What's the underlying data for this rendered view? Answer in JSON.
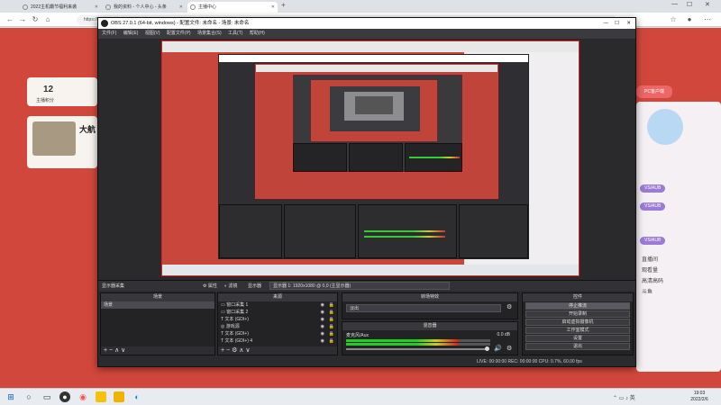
{
  "browser": {
    "tabs": [
      {
        "label": "2022主机霸节福利来袭"
      },
      {
        "label": "我的资料 - 个人中心 - 头条"
      },
      {
        "label": "主播中心"
      }
    ],
    "url": "https://",
    "window_controls": {
      "minimize": "—",
      "maximize": "☐",
      "close": "✕"
    }
  },
  "webpage": {
    "count": "12",
    "count_label": "主播积分",
    "username": "大航",
    "badge": "PC客户端",
    "pills": [
      "VS/AUB",
      "VS/AUB",
      "VS/AUB"
    ],
    "side_text": [
      "直播间",
      "观看量",
      "高清高码",
      "斗鱼"
    ]
  },
  "obs": {
    "title": "OBS 27.0.1 (64-bit, windows) - 配置文件: 未命名 - 场景: 未命名",
    "menu": [
      "文件(F)",
      "编辑(E)",
      "视图(V)",
      "配置文件(P)",
      "场景集合(S)",
      "工具(T)",
      "帮助(H)"
    ],
    "bar": {
      "display_label": "显示器采集",
      "properties": "属性",
      "filters": "滤镜",
      "display_select_label": "显示器",
      "display_select_value": "显示器 1: 1920x1080 @ 0,0 (主显示器)"
    },
    "scenes": {
      "header": "场景",
      "items": [
        "场景"
      ],
      "footer": "+ − ∧ ∨"
    },
    "sources": {
      "header": "来源",
      "items": [
        "窗口采集 1",
        "窗口采集 2",
        "文本 (GDI+)",
        "游戏源",
        "文本 (GDI+)",
        "文本 (GDI+) 4"
      ],
      "footer": "+ − ⚙ ∧ ∨"
    },
    "transitions": {
      "header": "转场特效",
      "value": "淡出"
    },
    "mixer": {
      "header": "混音器",
      "label": "麦克风/Aux",
      "db": "0.0 dB",
      "level": 0.78
    },
    "controls": {
      "header": "控件",
      "buttons": [
        "停止推流",
        "开始录制",
        "启动虚拟摄像机",
        "工作室模式",
        "设置",
        "退出"
      ]
    },
    "status": "LIVE: 00:00:00    REC: 00:00:00    CPU: 0.7%, 60.00 fps"
  },
  "taskbar": {
    "time": "19:03",
    "date": "2022/2/6"
  }
}
